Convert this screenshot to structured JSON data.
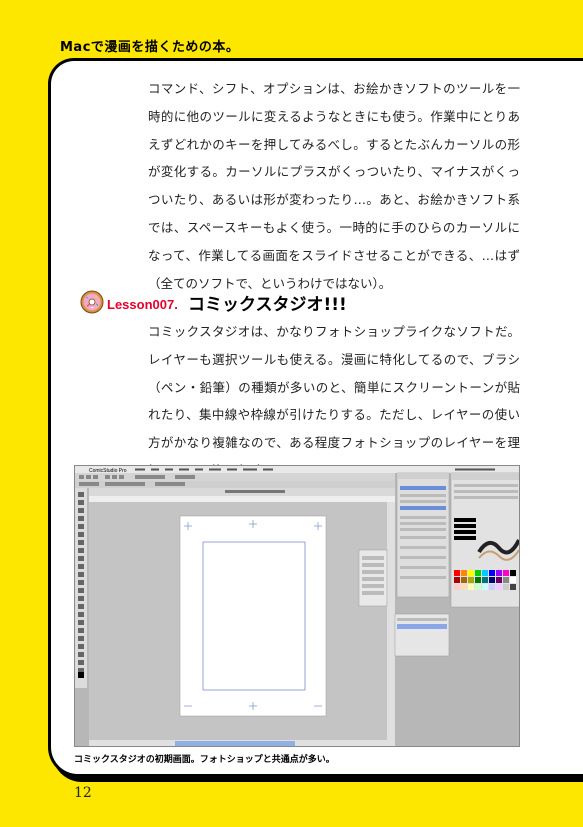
{
  "header": {
    "title": "Macで漫画を描くための本。"
  },
  "paragraph1": "コマンド、シフト、オプションは、お絵かきソフトのツールを一時的に他のツールに変えるようなときにも使う。作業中にとりあえずどれかのキーを押してみるべし。するとたぶんカーソルの形が変化する。カーソルにプラスがくっついたり、マイナスがくっついたり、あるいは形が変わったり…。あと、お絵かきソフト系では、スペースキーもよく使う。一時的に手のひらのカーソルになって、作業してる画面をスライドさせることができる、…はず（全てのソフトで、というわけではない）。",
  "lesson": {
    "number": "Lesson007.",
    "title": "コミックスタジオ!!!",
    "icon": "donut-icon"
  },
  "paragraph2": "コミックスタジオは、かなりフォトショップライクなソフトだ。レイヤーも選択ツールも使える。漫画に特化してるので、ブラシ（ペン・鉛筆）の種類が多いのと、簡単にスクリーントーンが貼れたり、集中線や枠線が引けたりする。ただし、レイヤーの使い方がかなり複雑なので、ある程度フォトショップのレイヤーを理解してから使う方がいいと思う。",
  "screenshot": {
    "app_name": "ComicStudio Pro"
  },
  "caption": "コミックスタジオの初期画面。フォトショップと共通点が多い。",
  "page_number": "12",
  "colors": {
    "background": "#fde600",
    "lesson_number": "#e4002b"
  }
}
